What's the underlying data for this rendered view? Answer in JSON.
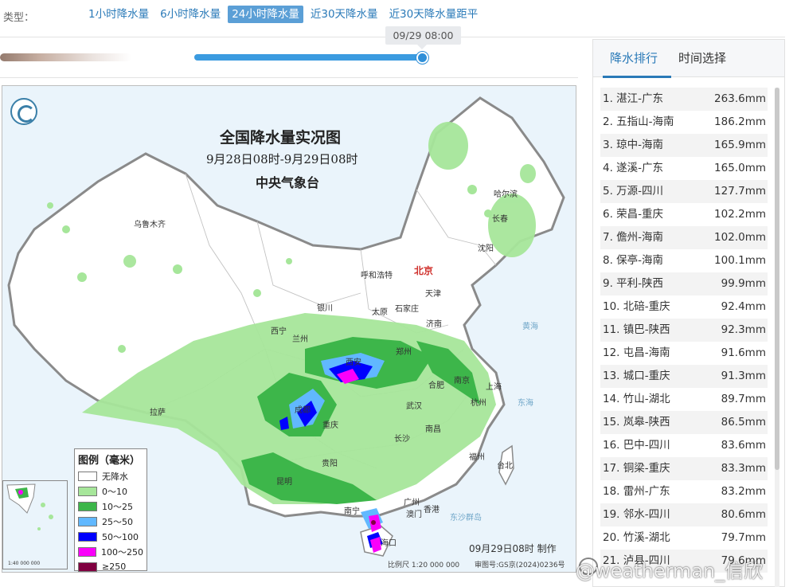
{
  "type_bar": {
    "label": "类型：",
    "tabs": [
      "1小时降水量",
      "6小时降水量",
      "24小时降水量",
      "近30天降水量",
      "近30天降水量距平"
    ],
    "active_index": 2
  },
  "timeline": {
    "tooltip": "09/29 08:00",
    "progress": 1.0
  },
  "map": {
    "title": "全国降水量实况图",
    "subtitle": "9月28日08时-9月29日08时",
    "organization": "中央气象台",
    "made_label": "09月29日08时 制作",
    "scale_label": "比例尺 1:20 000 000",
    "review_label": "审图号:GS京(2024)0236号",
    "inset_scale": "1:40 000 000",
    "capital": "北京",
    "cities": [
      "乌鲁木齐",
      "哈尔滨",
      "长春",
      "沈阳",
      "呼和浩特",
      "天津",
      "银川",
      "太原",
      "石家庄",
      "济南",
      "西宁",
      "兰州",
      "西安",
      "郑州",
      "合肥",
      "南京",
      "上海",
      "拉萨",
      "成都",
      "重庆",
      "武汉",
      "杭州",
      "长沙",
      "南昌",
      "贵阳",
      "福州",
      "台北",
      "昆明",
      "南宁",
      "广州",
      "澳门",
      "香港",
      "海口"
    ],
    "waters": [
      "黄海",
      "东海",
      "东沙群岛"
    ]
  },
  "legend": {
    "title": "图例（毫米）",
    "items": [
      {
        "label": "无降水",
        "color": "#ffffff"
      },
      {
        "label": "0～10",
        "color": "#a6e69a"
      },
      {
        "label": "10～25",
        "color": "#3db64a"
      },
      {
        "label": "25～50",
        "color": "#61b8ff"
      },
      {
        "label": "50～100",
        "color": "#0000fe"
      },
      {
        "label": "100～250",
        "color": "#fa00fa"
      },
      {
        "label": "≥250",
        "color": "#800040"
      }
    ]
  },
  "panel": {
    "tabs": [
      "降水排行",
      "时间选择"
    ],
    "active_tab": 0,
    "ranking": [
      {
        "name": "1. 湛江-广东",
        "value": "263.6mm"
      },
      {
        "name": "2. 五指山-海南",
        "value": "186.2mm"
      },
      {
        "name": "3. 琼中-海南",
        "value": "165.9mm"
      },
      {
        "name": "4. 遂溪-广东",
        "value": "165.0mm"
      },
      {
        "name": "5. 万源-四川",
        "value": "127.7mm"
      },
      {
        "name": "6. 荣昌-重庆",
        "value": "102.2mm"
      },
      {
        "name": "7. 儋州-海南",
        "value": "102.0mm"
      },
      {
        "name": "8. 保亭-海南",
        "value": "100.1mm"
      },
      {
        "name": "9. 平利-陕西",
        "value": "99.9mm"
      },
      {
        "name": "10. 北碚-重庆",
        "value": "92.4mm"
      },
      {
        "name": "11. 镇巴-陕西",
        "value": "92.3mm"
      },
      {
        "name": "12. 屯昌-海南",
        "value": "91.6mm"
      },
      {
        "name": "13. 城口-重庆",
        "value": "91.3mm"
      },
      {
        "name": "14. 竹山-湖北",
        "value": "89.7mm"
      },
      {
        "name": "15. 岚皋-陕西",
        "value": "86.5mm"
      },
      {
        "name": "16. 巴中-四川",
        "value": "83.6mm"
      },
      {
        "name": "17. 铜梁-重庆",
        "value": "83.3mm"
      },
      {
        "name": "18. 雷州-广东",
        "value": "83.2mm"
      },
      {
        "name": "19. 邻水-四川",
        "value": "80.6mm"
      },
      {
        "name": "20. 竹溪-湖北",
        "value": "79.7mm"
      },
      {
        "name": "21. 泸县-四川",
        "value": "79.6mm"
      }
    ]
  },
  "watermark": "@weatherman_信欣"
}
